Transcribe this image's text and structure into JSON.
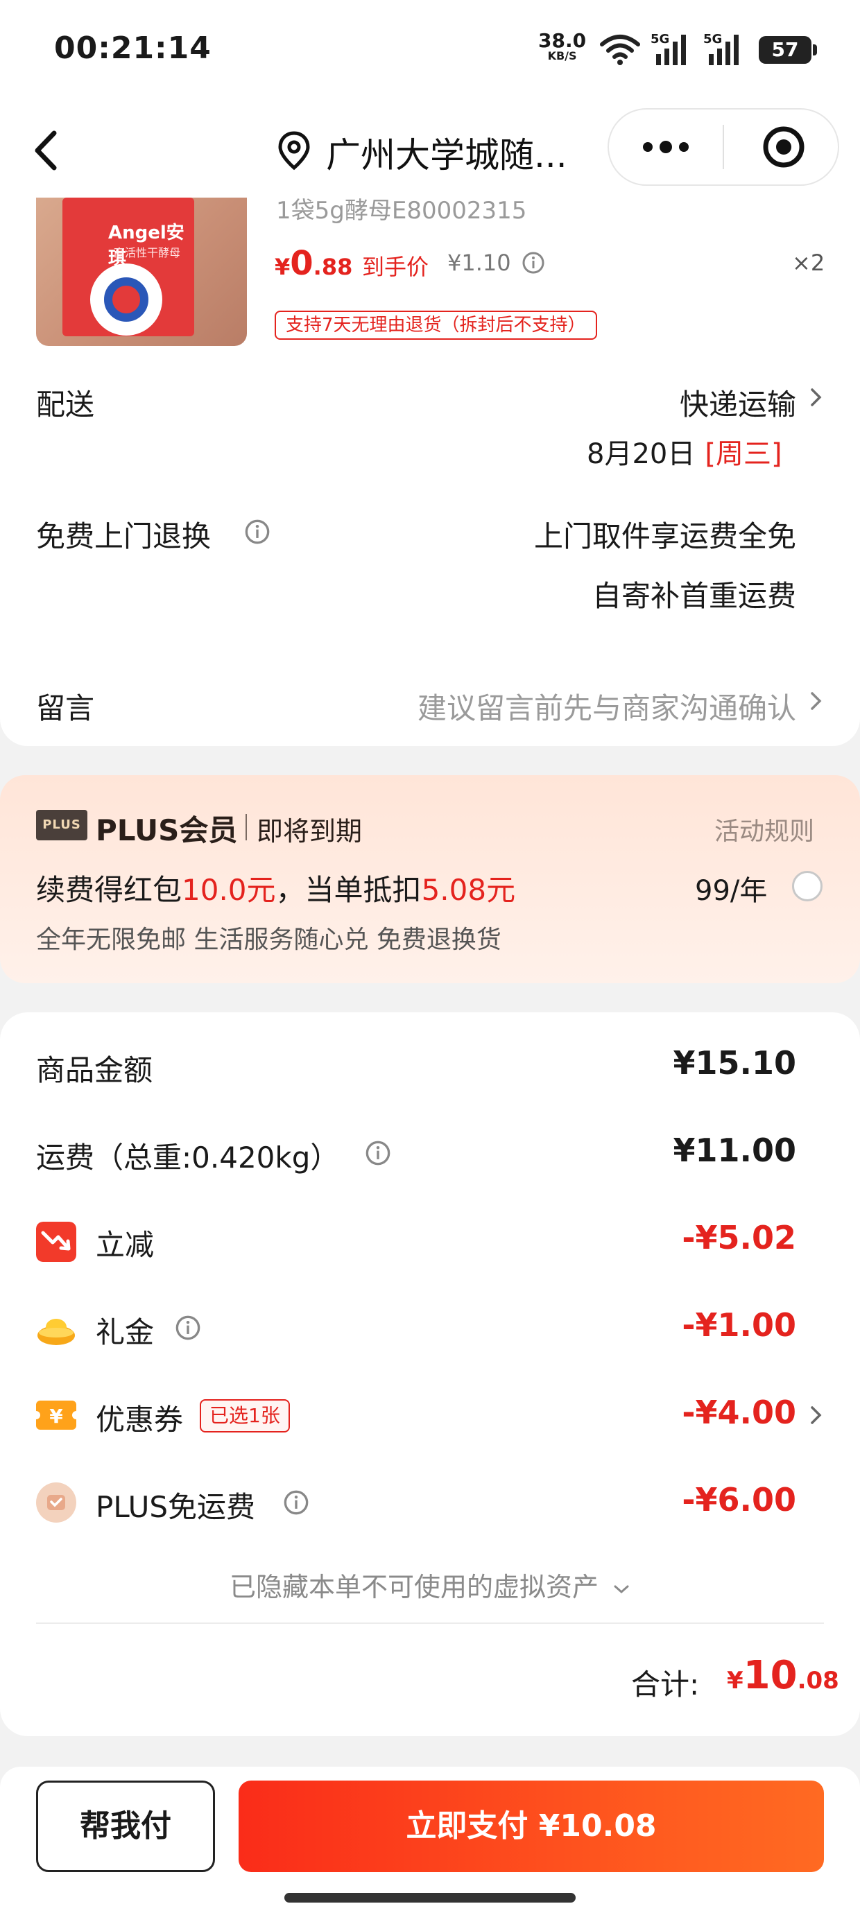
{
  "status_bar": {
    "time": "00:21:14",
    "net_speed": "38.0",
    "net_unit": "KB/S",
    "signal_1": "5G",
    "signal_2": "5G",
    "battery": "57"
  },
  "nav": {
    "title": "广州大学城随..."
  },
  "product": {
    "title": "1袋5g酵母E80002315",
    "price_currency": "¥",
    "price_int": "0",
    "price_dec": ".88",
    "final_price_label": "到手价",
    "original_price": "¥1.10",
    "quantity": "×2",
    "return_policy": "支持7天无理由退货（拆封后不支持）",
    "image_brand": "Angel安琪",
    "image_subtitle": "高活性干酵母"
  },
  "delivery": {
    "label": "配送",
    "method": "快递运输",
    "date": "8月20日",
    "weekday": "[周三]"
  },
  "free_return": {
    "label": "免费上门退换",
    "line1": "上门取件享运费全免",
    "line2": "自寄补首重运费"
  },
  "message": {
    "label": "留言",
    "placeholder": "建议留言前先与商家沟通确认"
  },
  "plus": {
    "badge": "PLUS",
    "title": "PLUS会员",
    "expire": "即将到期",
    "rules": "活动规则",
    "renew_prefix": "续费得红包",
    "renew_amount": "10.0元",
    "renew_mid": "，当单抵扣",
    "renew_deduct": "5.08元",
    "price": "99/年",
    "benefits": "全年无限免邮 生活服务随心兑 免费退换货"
  },
  "summary": {
    "goods_label": "商品金额",
    "goods_value": "¥15.10",
    "shipping_label": "运费（总重:0.420kg）",
    "shipping_value": "¥11.00",
    "discount_label": "立减",
    "discount_value": "-¥5.02",
    "gift_label": "礼金",
    "gift_value": "-¥1.00",
    "coupon_label": "优惠券",
    "coupon_badge": "已选1张",
    "coupon_value": "-¥4.00",
    "plus_ship_label": "PLUS免运费",
    "plus_ship_value": "-¥6.00",
    "hidden_assets": "已隐藏本单不可使用的虚拟资产",
    "total_label": "合计:",
    "total_currency": "¥",
    "total_int": "10",
    "total_dec": ".08"
  },
  "bottom": {
    "help_pay": "帮我付",
    "pay_now": "立即支付 ¥10.08"
  },
  "colors": {
    "accent_red": "#e4231e",
    "pay_gradient_start": "#fa2c19",
    "pay_gradient_end": "#ff6a22",
    "plus_bg": "#ffe5d8"
  }
}
